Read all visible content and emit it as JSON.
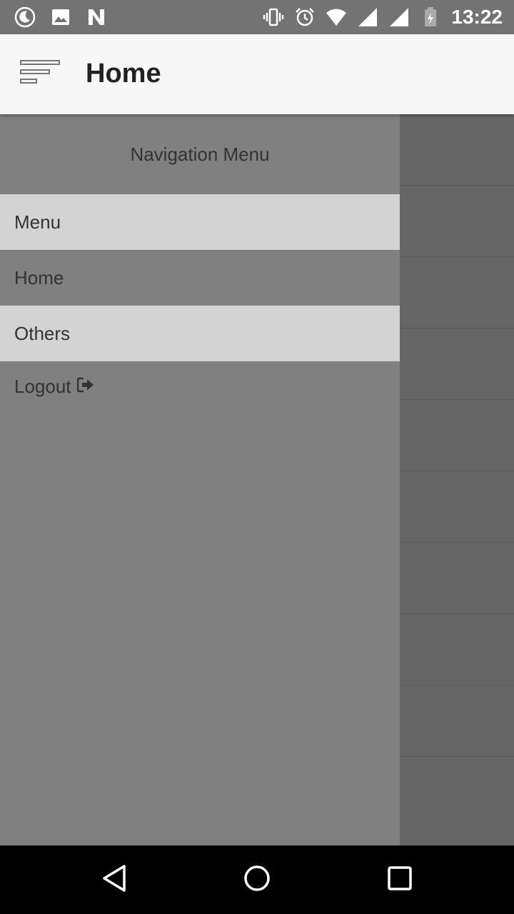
{
  "status_bar": {
    "time": "13:22",
    "left_icons": [
      "moon-icon",
      "image-icon",
      "n-icon"
    ],
    "right_icons": [
      "vibrate-icon",
      "alarm-icon",
      "wifi-icon",
      "signal-icon",
      "signal-icon",
      "battery-icon"
    ]
  },
  "app_bar": {
    "title": "Home",
    "menu_icon": "sort-menu-icon"
  },
  "drawer": {
    "header": "Navigation Menu",
    "items": [
      {
        "label": "Menu"
      },
      {
        "label": "Home"
      },
      {
        "label": "Others"
      }
    ],
    "logout": {
      "label": "Logout",
      "icon": "sign-out-icon"
    }
  },
  "nav_bar": {
    "icons": [
      "back-icon",
      "home-icon",
      "recents-icon"
    ]
  },
  "colors": {
    "status_bar": "#737373",
    "app_bar": "#f7f7f7",
    "drawer": "#808080",
    "drawer_item_highlight": "#d3d3d3",
    "scrim": "#666666",
    "nav_bar": "#000000"
  }
}
